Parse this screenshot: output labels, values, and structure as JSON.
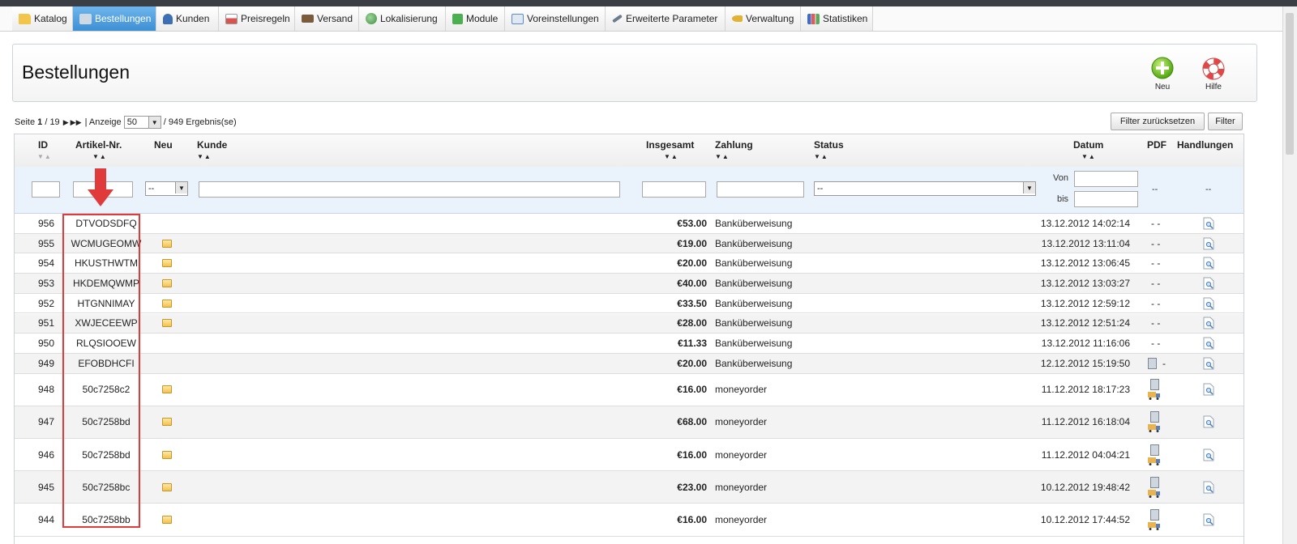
{
  "tabs": [
    {
      "label": "Katalog",
      "icon": "folder-icon",
      "color": "#f3c54b"
    },
    {
      "label": "Bestellungen",
      "icon": "cart-icon",
      "color": "#8fa6bd"
    },
    {
      "label": "Kunden",
      "icon": "user-icon",
      "color": "#3d6fb4"
    },
    {
      "label": "Preisregeln",
      "icon": "price-rules-icon",
      "color": "#d9534f"
    },
    {
      "label": "Versand",
      "icon": "truck-icon",
      "color": "#7a5c3c"
    },
    {
      "label": "Lokalisierung",
      "icon": "globe-icon",
      "color": "#4a9e4a"
    },
    {
      "label": "Module",
      "icon": "puzzle-icon",
      "color": "#4caf50"
    },
    {
      "label": "Voreinstellungen",
      "icon": "preferences-icon",
      "color": "#5b8ccf"
    },
    {
      "label": "Erweiterte Parameter",
      "icon": "wrench-icon",
      "color": "#6d7c8d"
    },
    {
      "label": "Verwaltung",
      "icon": "key-icon",
      "color": "#e1b233"
    },
    {
      "label": "Statistiken",
      "icon": "bar-chart-icon",
      "color": "#3f6cc4"
    }
  ],
  "page": {
    "title": "Bestellungen",
    "new_label": "Neu",
    "help_label": "Hilfe"
  },
  "pager": {
    "page_prefix": "Seite",
    "current_page": "1",
    "total_pages": "/ 19",
    "display_label": "| Anzeige",
    "per_page": "50",
    "results": "/ 949 Ergebnis(se)"
  },
  "buttons": {
    "reset_filter": "Filter zurücksetzen",
    "filter": "Filter"
  },
  "columns": {
    "id": "ID",
    "reference": "Artikel-Nr.",
    "new": "Neu",
    "customer": "Kunde",
    "total": "Insgesamt",
    "payment": "Zahlung",
    "status": "Status",
    "date": "Datum",
    "pdf": "PDF",
    "actions": "Handlungen"
  },
  "filters": {
    "new_value": "--",
    "status_value": "--",
    "date_from_label": "Von",
    "date_to_label": "bis",
    "pdf_placeholder": "--",
    "actions_placeholder": "--"
  },
  "orders": [
    {
      "id": "956",
      "ref": "DTVODSDFQ",
      "new": false,
      "total": "€53.00",
      "payment": "Banküberweisung",
      "date": "13.12.2012 14:02:14",
      "pdf": "- -"
    },
    {
      "id": "955",
      "ref": "WCMUGEOMW",
      "new": true,
      "total": "€19.00",
      "payment": "Banküberweisung",
      "date": "13.12.2012 13:11:04",
      "pdf": "- -"
    },
    {
      "id": "954",
      "ref": "HKUSTHWTM",
      "new": true,
      "total": "€20.00",
      "payment": "Banküberweisung",
      "date": "13.12.2012 13:06:45",
      "pdf": "- -"
    },
    {
      "id": "953",
      "ref": "HKDEMQWMP",
      "new": true,
      "total": "€40.00",
      "payment": "Banküberweisung",
      "date": "13.12.2012 13:03:27",
      "pdf": "- -"
    },
    {
      "id": "952",
      "ref": "HTGNNIMAY",
      "new": true,
      "total": "€33.50",
      "payment": "Banküberweisung",
      "date": "13.12.2012 12:59:12",
      "pdf": "- -"
    },
    {
      "id": "951",
      "ref": "XWJECEEWP",
      "new": true,
      "total": "€28.00",
      "payment": "Banküberweisung",
      "date": "13.12.2012 12:51:24",
      "pdf": "- -"
    },
    {
      "id": "950",
      "ref": "RLQSIOOEW",
      "new": false,
      "total": "€11.33",
      "payment": "Banküberweisung",
      "date": "13.12.2012 11:16:06",
      "pdf": "- -"
    },
    {
      "id": "949",
      "ref": "EFOBDHCFI",
      "new": false,
      "total": "€20.00",
      "payment": "Banküberweisung",
      "date": "12.12.2012 15:19:50",
      "pdf": "invoice"
    },
    {
      "id": "948",
      "ref": "50c7258c2",
      "new": true,
      "total": "€16.00",
      "payment": "moneyorder",
      "date": "11.12.2012 18:17:23",
      "pdf": "invoice+delivery"
    },
    {
      "id": "947",
      "ref": "50c7258bd",
      "new": true,
      "total": "€68.00",
      "payment": "moneyorder",
      "date": "11.12.2012 16:18:04",
      "pdf": "invoice+delivery"
    },
    {
      "id": "946",
      "ref": "50c7258bd",
      "new": true,
      "total": "€16.00",
      "payment": "moneyorder",
      "date": "11.12.2012 04:04:21",
      "pdf": "invoice+delivery"
    },
    {
      "id": "945",
      "ref": "50c7258bc",
      "new": true,
      "total": "€23.00",
      "payment": "moneyorder",
      "date": "10.12.2012 19:48:42",
      "pdf": "invoice+delivery"
    },
    {
      "id": "944",
      "ref": "50c7258bb",
      "new": true,
      "total": "€16.00",
      "payment": "moneyorder",
      "date": "10.12.2012 17:44:52",
      "pdf": "invoice+delivery"
    }
  ],
  "annotation": {
    "color": "#e03a3a"
  }
}
